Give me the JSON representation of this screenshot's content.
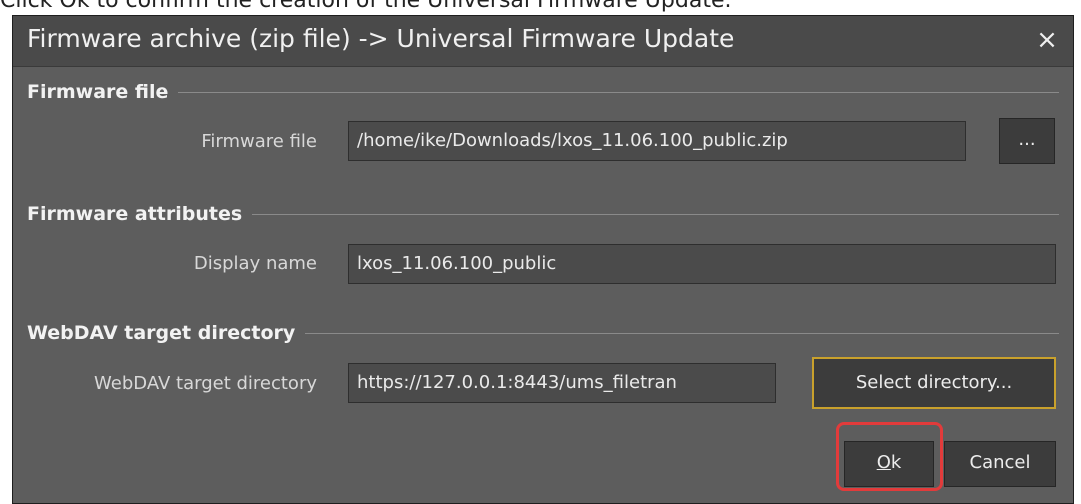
{
  "caption": "Click Ok to confirm the creation of the Universal Firmware Update.",
  "dialog": {
    "title": "Firmware archive (zip file) -> Universal Firmware Update",
    "close_glyph": "×",
    "sections": {
      "firmware_file": {
        "header": "Firmware file",
        "label": "Firmware file",
        "value": "/home/ike/Downloads/lxos_11.06.100_public.zip",
        "browse_label": "..."
      },
      "firmware_attributes": {
        "header": "Firmware attributes",
        "label": "Display name",
        "value": "lxos_11.06.100_public"
      },
      "webdav": {
        "header": "WebDAV target directory",
        "label": "WebDAV target directory",
        "value": "https://127.0.0.1:8443/ums_filetran",
        "select_label": "Select directory..."
      }
    },
    "buttons": {
      "ok_label": "Ok",
      "cancel_label": "Cancel"
    }
  },
  "colors": {
    "dialog_bg": "#5d5d5d",
    "titlebar_bg": "#4a4a4a",
    "field_bg": "#4b4b4b",
    "focus_accent": "#c9a12c",
    "highlight_ring": "#e23b3b"
  },
  "icons": {
    "close": "close-icon",
    "browse": "ellipsis-icon"
  }
}
